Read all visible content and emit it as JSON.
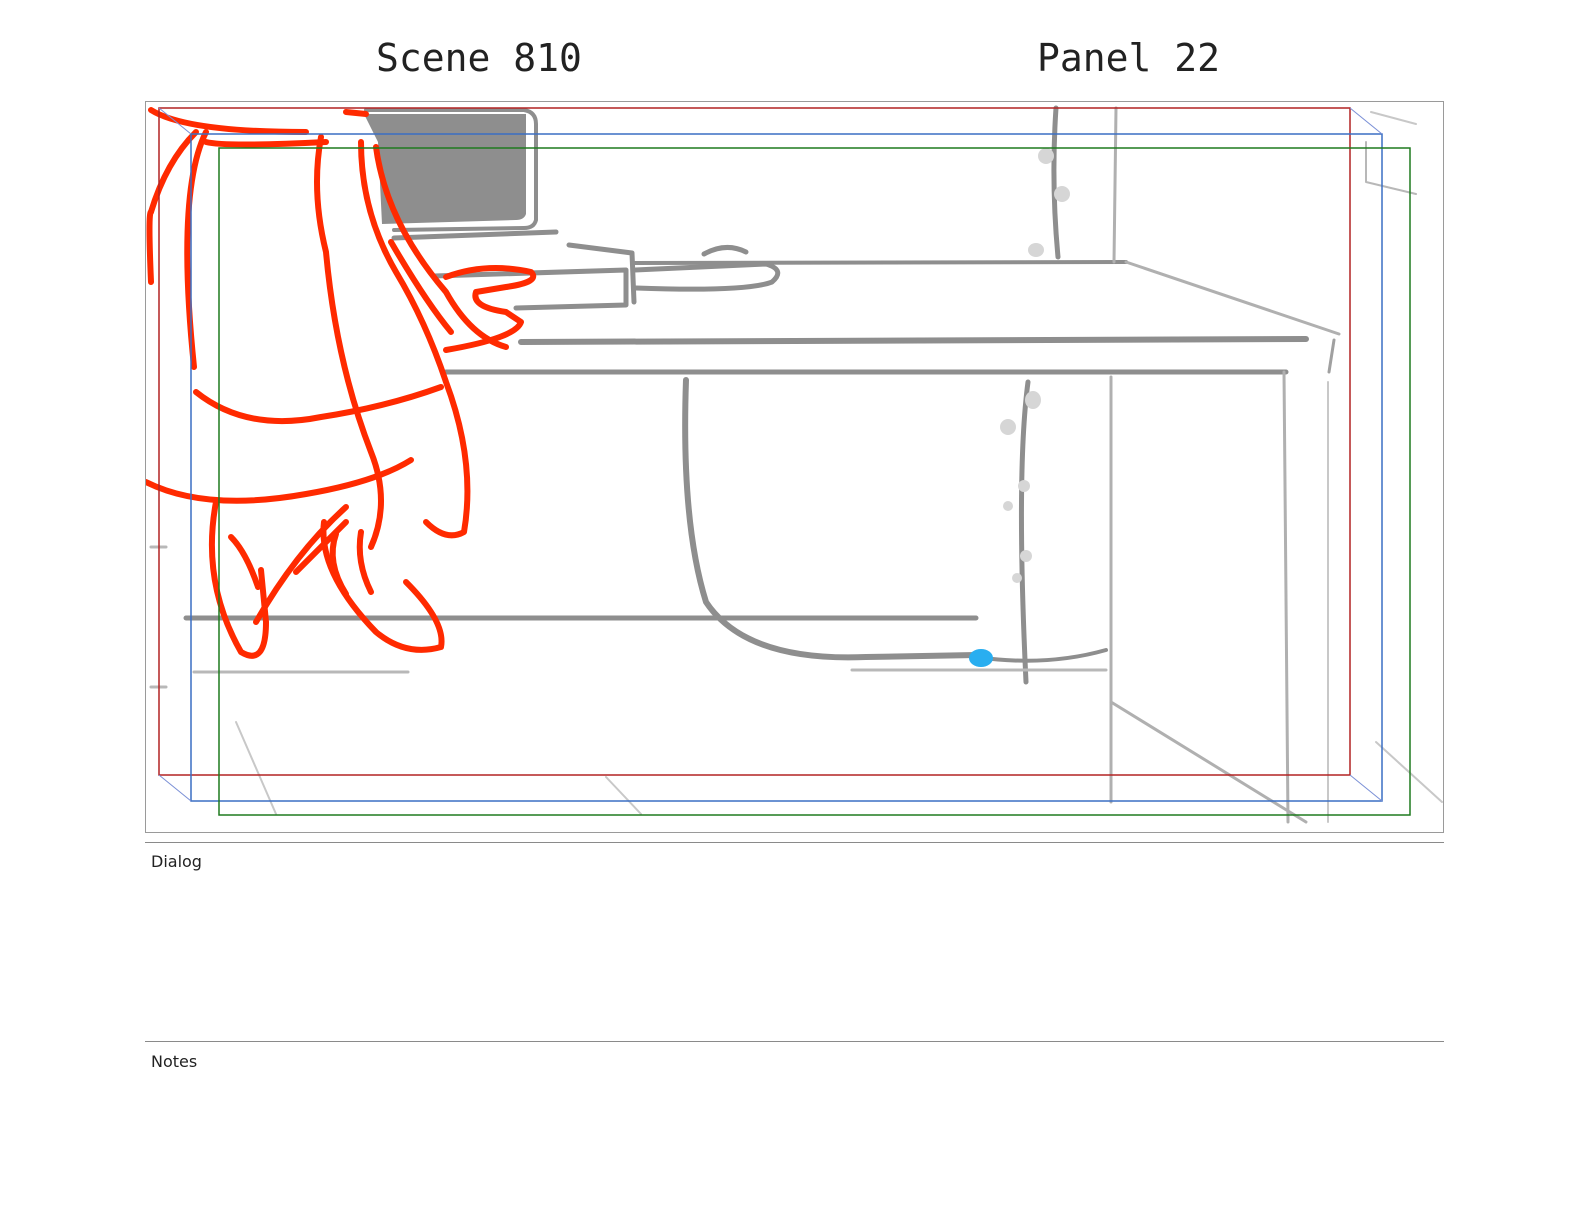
{
  "header": {
    "scene": "Scene 810",
    "panel": "Panel 22"
  },
  "sections": {
    "dialog_label": "Dialog",
    "dialog_text": "",
    "notes_label": "Notes",
    "notes_text": ""
  },
  "colors": {
    "sketch_red": "#ff2a00",
    "background_gray": "#8e8e8e",
    "safe_frame_red": "#b22222",
    "safe_frame_blue": "#3a6fc4",
    "safe_frame_green": "#1f7a1f",
    "accent_blue_dot": "#29aef0"
  }
}
